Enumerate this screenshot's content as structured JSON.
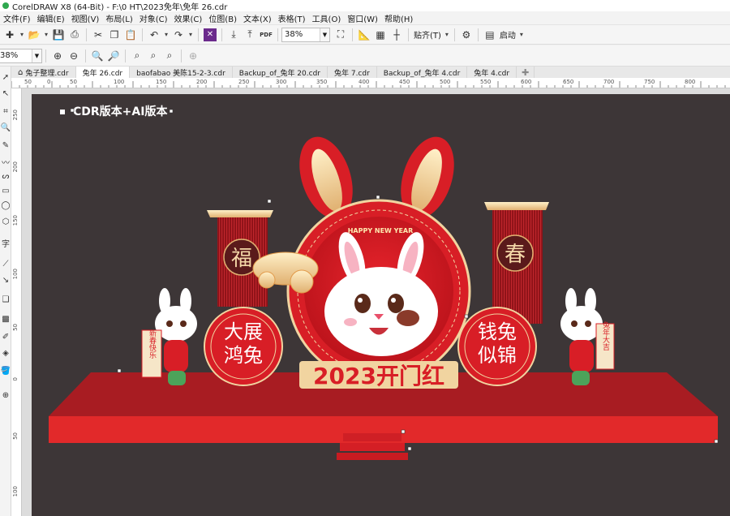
{
  "window": {
    "title": "CorelDRAW X8 (64-Bit) - F:\\0 HT\\2023免年\\免年 26.cdr"
  },
  "menu": [
    {
      "label": "文件(F)"
    },
    {
      "label": "编辑(E)"
    },
    {
      "label": "视图(V)"
    },
    {
      "label": "布局(L)"
    },
    {
      "label": "对象(C)"
    },
    {
      "label": "效果(C)"
    },
    {
      "label": "位图(B)"
    },
    {
      "label": "文本(X)"
    },
    {
      "label": "表格(T)"
    },
    {
      "label": "工具(O)"
    },
    {
      "label": "窗口(W)"
    },
    {
      "label": "帮助(H)"
    }
  ],
  "toolbar": {
    "zoom_value": "38%",
    "snap_label": "贴齐(T)",
    "launch_label": "启动",
    "pdf_label": "PDF"
  },
  "propbar": {
    "zoom_value": "38%"
  },
  "tabs": [
    {
      "label": "兔子整理.cdr"
    },
    {
      "label": "兔年 26.cdr"
    },
    {
      "label": "baofabao 美陈15-2-3.cdr"
    },
    {
      "label": "Backup_of_兔年 20.cdr"
    },
    {
      "label": "兔年 7.cdr"
    },
    {
      "label": "Backup_of_兔年 4.cdr"
    },
    {
      "label": "兔年 4.cdr"
    }
  ],
  "ruler_h": [
    "50",
    "0",
    "50",
    "100",
    "150",
    "200",
    "250",
    "300",
    "350",
    "400",
    "450",
    "500",
    "550",
    "600",
    "650",
    "700",
    "750",
    "800"
  ],
  "ruler_v": [
    "250",
    "200",
    "150",
    "100",
    "50",
    "0",
    "50",
    "100"
  ],
  "canvas": {
    "page_color": "#3d3637",
    "version_label": "CDR版本+AI版本",
    "artwork": {
      "top_banner": "HAPPY NEW YEAR",
      "year_text": "2023开门红",
      "left_medallion": "福",
      "right_medallion": "春",
      "left_circle_text": [
        "大展",
        "鸿兔"
      ],
      "right_circle_text": [
        "钱兔",
        "似锦"
      ],
      "left_scroll": "新春快乐",
      "right_scroll": "兔年大吉",
      "colors": {
        "red": "#d81e26",
        "dark_red": "#a81319",
        "gold": "#f1d4a0",
        "stage": "#e2292a",
        "stage_top": "#a81c22"
      }
    }
  },
  "icons": {
    "toolbar": [
      "new-icon",
      "open-icon",
      "save-icon",
      "print-icon",
      "cut-icon",
      "copy-icon",
      "paste-icon",
      "undo-icon",
      "redo-icon",
      "corel-connect-icon",
      "import-icon",
      "export-icon",
      "publish-pdf-icon",
      "full-screen-icon",
      "rulers-icon",
      "grid-icon",
      "guidelines-icon",
      "options-icon",
      "application-launcher-icon"
    ]
  }
}
